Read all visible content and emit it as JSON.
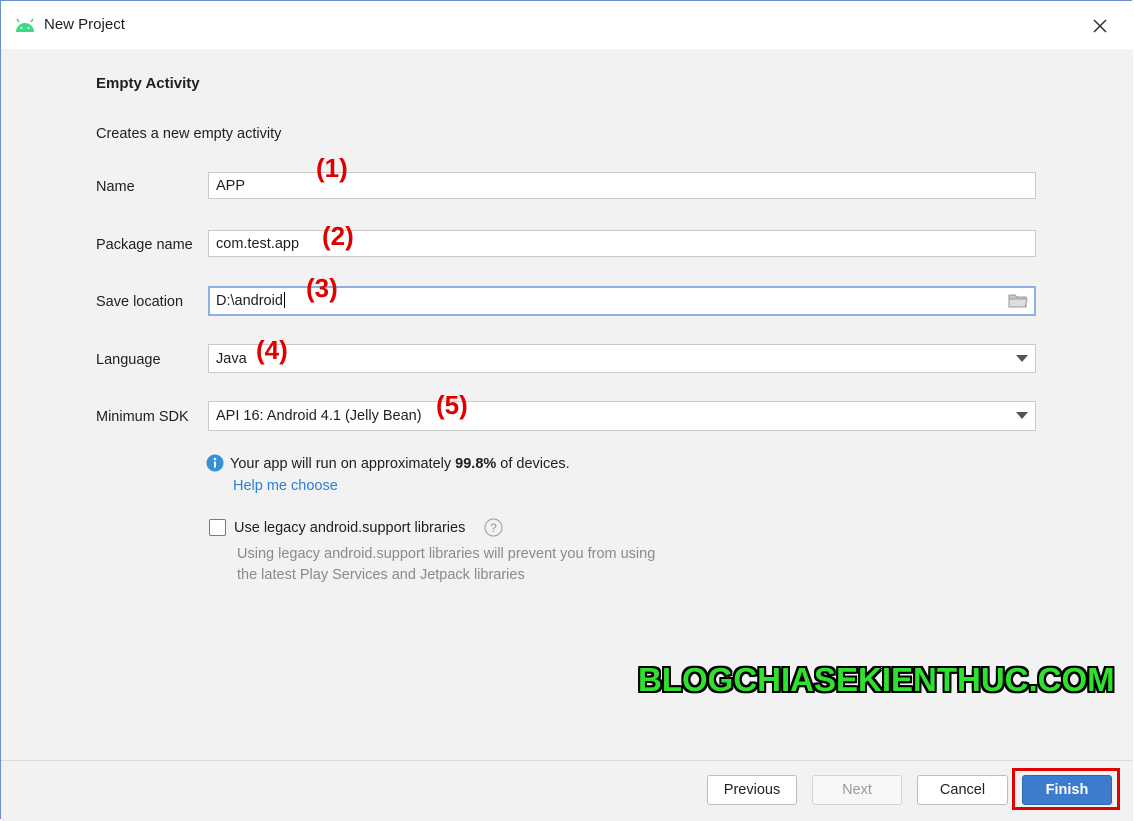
{
  "window": {
    "title": "New Project"
  },
  "header": {
    "heading": "Empty Activity",
    "description": "Creates a new empty activity"
  },
  "form": {
    "name": {
      "label": "Name",
      "value": "APP"
    },
    "package": {
      "label": "Package name",
      "value": "com.test.app"
    },
    "location": {
      "label": "Save location",
      "value": "D:\\android"
    },
    "language": {
      "label": "Language",
      "value": "Java"
    },
    "min_sdk": {
      "label": "Minimum SDK",
      "value": "API 16: Android 4.1 (Jelly Bean)"
    }
  },
  "annotations": [
    "(1)",
    "(2)",
    "(3)",
    "(4)",
    "(5)"
  ],
  "info": {
    "prefix": "Your app will run on approximately ",
    "percent": "99.8%",
    "suffix": " of devices.",
    "help_link": "Help me choose"
  },
  "legacy": {
    "label": "Use legacy android.support libraries",
    "checked": false,
    "hint_line1": "Using legacy android.support libraries will prevent you from using",
    "hint_line2": "the latest Play Services and Jetpack libraries"
  },
  "watermark": "BLOGCHIASEKIENTHUC.COM",
  "buttons": {
    "previous": "Previous",
    "next": "Next",
    "cancel": "Cancel",
    "finish": "Finish"
  },
  "colors": {
    "android_green": "#3ddc84",
    "link": "#2d7fd0",
    "primary_button": "#3d7bcc",
    "annotation_red": "#e00000",
    "watermark_green": "#2fe02f"
  },
  "icons": [
    "android-logo-icon",
    "close-icon",
    "folder-icon",
    "dropdown-arrow-icon",
    "info-icon",
    "question-icon"
  ]
}
